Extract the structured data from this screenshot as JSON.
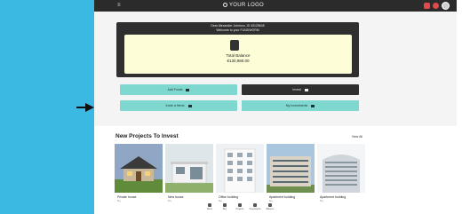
{
  "topbar": {
    "logo_text": "YOUR LOGO",
    "menu_icon": "hamburger-icon",
    "icons": [
      "notification-icon",
      "message-icon",
      "avatar"
    ]
  },
  "welcome": {
    "line1": "Dear Alexander Johnson, ID 43125645",
    "line2": "Welcome to your FUNDWORM"
  },
  "balance": {
    "label": "Total Balance",
    "value": "€130,980.00"
  },
  "actions": {
    "add_funds": "Add Funds",
    "invest": "Invest",
    "invite": "Invite a friend",
    "investments": "My Investments"
  },
  "projects": {
    "title": "New Projects To Invest",
    "view_all": "View All",
    "cards": [
      {
        "title": "Private house",
        "sub": "Buy"
      },
      {
        "title": "New house",
        "sub": "Buy"
      },
      {
        "title": "Office building",
        "sub": "Buy"
      },
      {
        "title": "Apartment building",
        "sub": "Buy"
      },
      {
        "title": "Apartment building",
        "sub": "Buy"
      }
    ]
  },
  "bottom_nav": [
    {
      "label": "Menu",
      "icon": "home-icon"
    },
    {
      "label": "Buy",
      "icon": "cart-icon"
    },
    {
      "label": "Projects",
      "icon": "grid-icon"
    },
    {
      "label": "Investments",
      "icon": "chart-icon"
    },
    {
      "label": "Balance",
      "icon": "wallet-icon"
    }
  ],
  "colors": {
    "side": "#3bb9e3",
    "teal": "#7fd8cf",
    "dark": "#2f2f2f",
    "balance_bg": "#fdfdd8"
  }
}
